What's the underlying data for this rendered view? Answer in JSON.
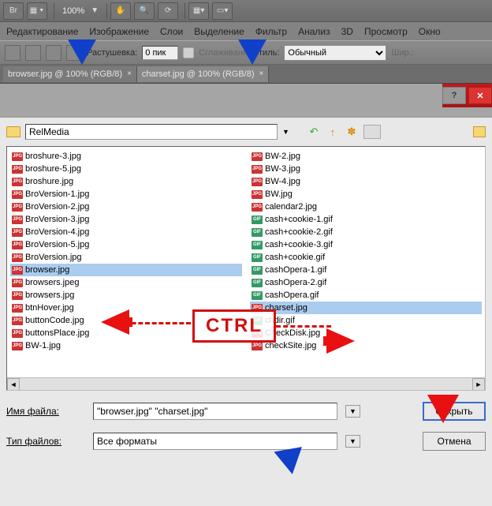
{
  "topbar": {
    "br": "Br",
    "zoom": "100%",
    "dn1": "▼",
    "dn2": "▼"
  },
  "menu": {
    "edit": "Редактирование",
    "image": "Изображение",
    "layers": "Слои",
    "select": "Выделение",
    "filter": "Фильтр",
    "analysis": "Анализ",
    "threeD": "3D",
    "view": "Просмотр",
    "window": "Окно"
  },
  "options": {
    "feather_lbl": "Растушевка:",
    "feather_val": "0 пик",
    "antialias_lbl": "Сглаживани",
    "style_lbl": "Стиль:",
    "style_val": "Обычный",
    "width_lbl": "Шир.:"
  },
  "tabs": {
    "t1": "browser.jpg @ 100% (RGB/8)",
    "t2": "charset.jpg @ 100% (RGB/8)"
  },
  "dialog": {
    "path": "RelMedia",
    "glyph_back": "↶",
    "glyph_up": "↑",
    "glyph_new": "✽",
    "left": [
      {
        "n": "broshure-3.jpg",
        "t": "jpg"
      },
      {
        "n": "broshure-5.jpg",
        "t": "jpg"
      },
      {
        "n": "broshure.jpg",
        "t": "jpg"
      },
      {
        "n": "BroVersion-1.jpg",
        "t": "jpg"
      },
      {
        "n": "BroVersion-2.jpg",
        "t": "jpg"
      },
      {
        "n": "BroVersion-3.jpg",
        "t": "jpg"
      },
      {
        "n": "BroVersion-4.jpg",
        "t": "jpg"
      },
      {
        "n": "BroVersion-5.jpg",
        "t": "jpg"
      },
      {
        "n": "BroVersion.jpg",
        "t": "jpg"
      },
      {
        "n": "browser.jpg",
        "t": "jpg",
        "sel": true
      },
      {
        "n": "browsers.jpeg",
        "t": "jpg"
      },
      {
        "n": "browsers.jpg",
        "t": "jpg"
      },
      {
        "n": "btnHover.jpg",
        "t": "jpg"
      },
      {
        "n": "buttonCode.jpg",
        "t": "jpg"
      },
      {
        "n": "buttonsPlace.jpg",
        "t": "jpg"
      },
      {
        "n": "BW-1.jpg",
        "t": "jpg"
      }
    ],
    "right": [
      {
        "n": "BW-2.jpg",
        "t": "jpg"
      },
      {
        "n": "BW-3.jpg",
        "t": "jpg"
      },
      {
        "n": "BW-4.jpg",
        "t": "jpg"
      },
      {
        "n": "BW.jpg",
        "t": "jpg"
      },
      {
        "n": "calendar2.jpg",
        "t": "jpg"
      },
      {
        "n": "cash+cookie-1.gif",
        "t": "gif"
      },
      {
        "n": "cash+cookie-2.gif",
        "t": "gif"
      },
      {
        "n": "cash+cookie-3.gif",
        "t": "gif"
      },
      {
        "n": "cash+cookie.gif",
        "t": "gif"
      },
      {
        "n": "cashOpera-1.gif",
        "t": "gif"
      },
      {
        "n": "cashOpera-2.gif",
        "t": "gif"
      },
      {
        "n": "cashOpera.gif",
        "t": "gif"
      },
      {
        "n": "charset.jpg",
        "t": "jpg",
        "sel": true
      },
      {
        "n": "chdir.gif",
        "t": "gif"
      },
      {
        "n": "CheckDisk.jpg",
        "t": "jpg"
      },
      {
        "n": "checkSite.jpg",
        "t": "jpg"
      }
    ],
    "fname_lbl": "Имя файла:",
    "fname_val": "\"browser.jpg\" \"charset.jpg\"",
    "ftype_lbl": "Тип файлов:",
    "ftype_val": "Все форматы",
    "open_btn": "Открыть",
    "cancel_btn": "Отмена",
    "help": "?",
    "close": "✕",
    "arr_l": "◄",
    "arr_r": "►"
  },
  "annot": {
    "ctrl": "CTRL"
  }
}
